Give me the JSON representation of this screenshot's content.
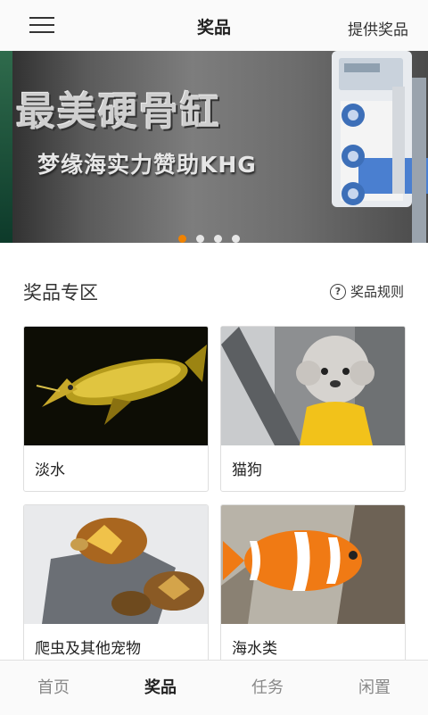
{
  "header": {
    "title": "奖品",
    "action_label": "提供奖品",
    "menu_icon": "hamburger-menu-icon"
  },
  "banner": {
    "title": "最美硬骨缸",
    "subtitle": "梦缘海实力赞助KHG",
    "dots_total": 4,
    "active_dot": 1,
    "accent_color": "#f08200"
  },
  "section": {
    "title": "奖品专区",
    "rules_label": "奖品规则",
    "rules_icon": "question-circle-icon"
  },
  "cards": [
    {
      "label": "淡水"
    },
    {
      "label": "猫狗"
    },
    {
      "label": "爬虫及其他宠物"
    },
    {
      "label": "海水类"
    }
  ],
  "nav": {
    "active": "奖品",
    "items": [
      {
        "label": "首页"
      },
      {
        "label": "奖品"
      },
      {
        "label": "任务"
      },
      {
        "label": "闲置"
      }
    ]
  }
}
